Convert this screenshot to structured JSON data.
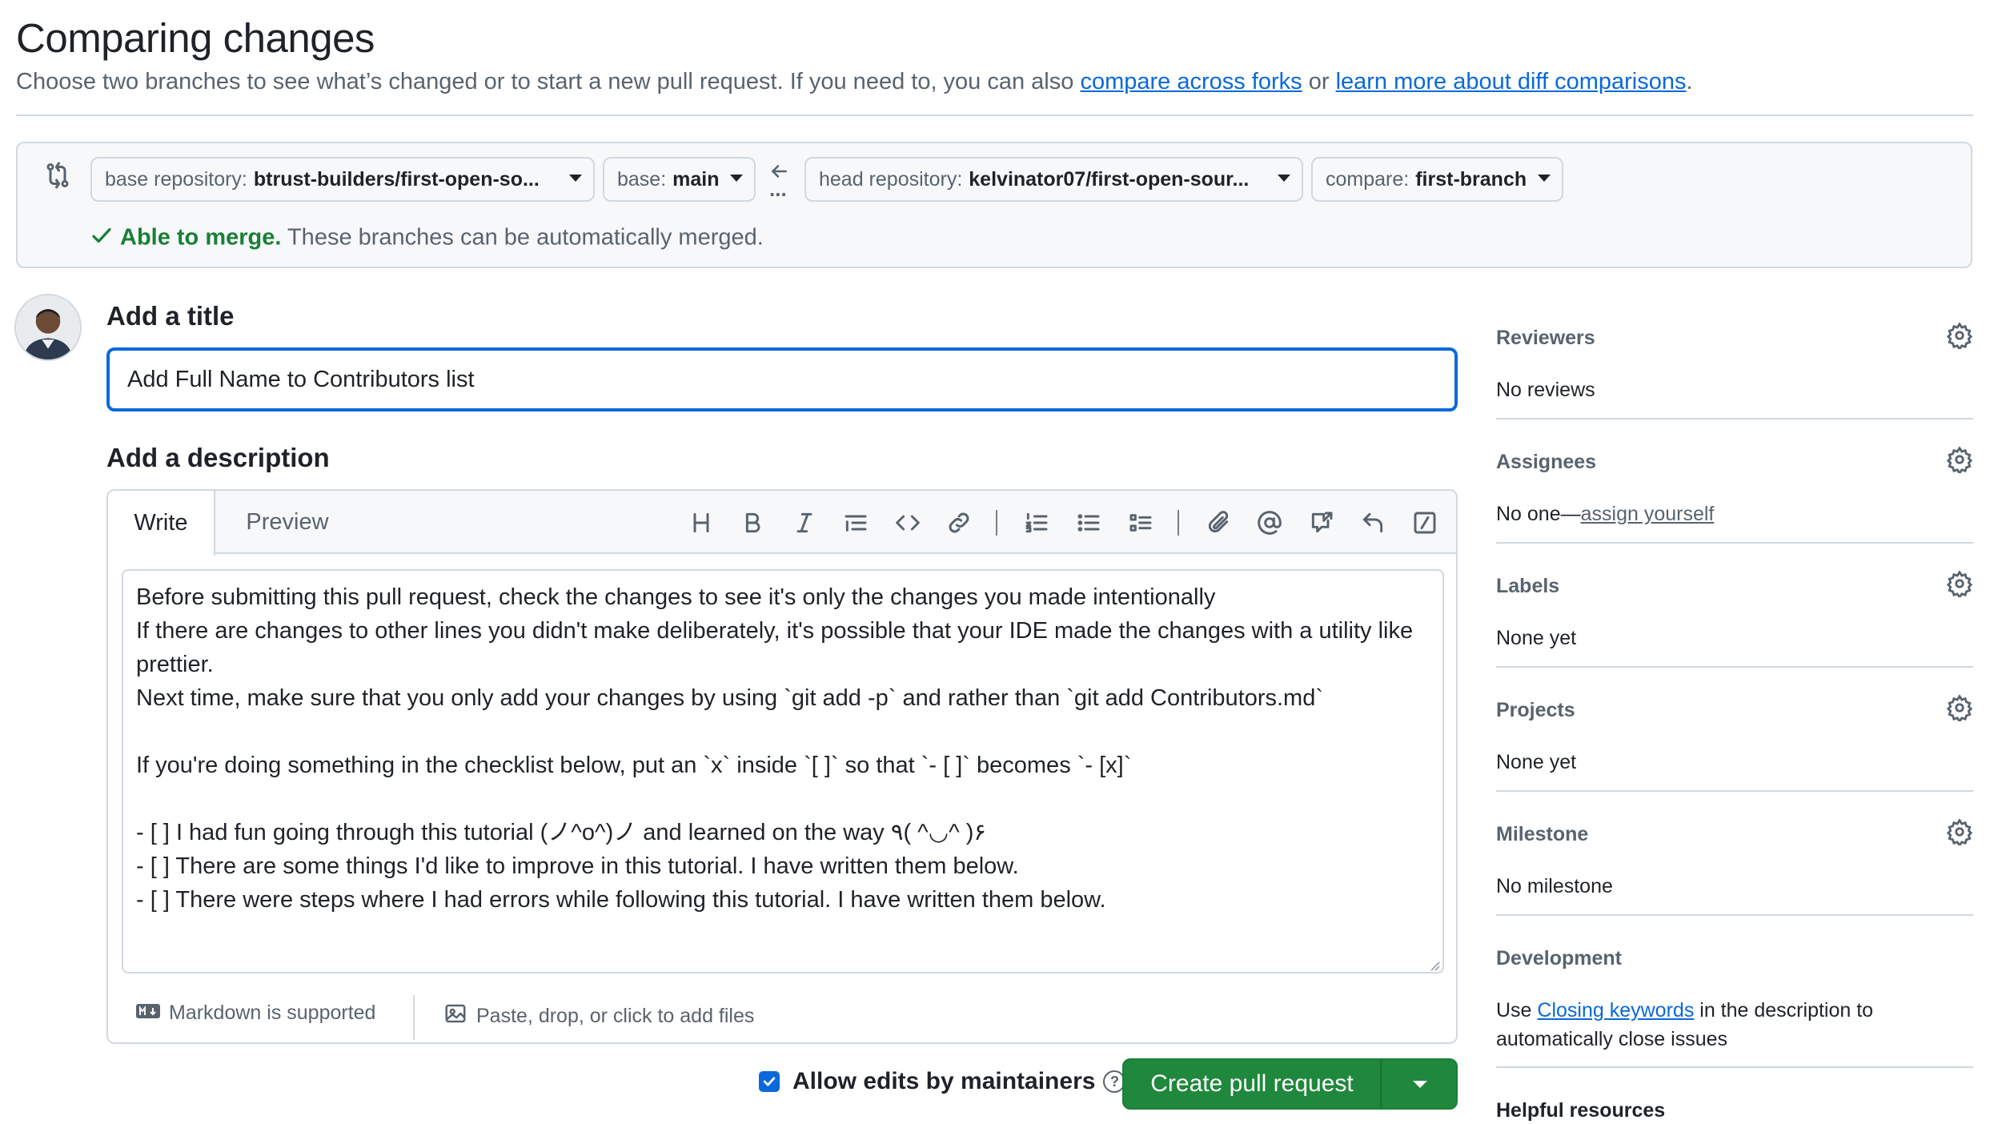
{
  "page": {
    "title": "Comparing changes",
    "subtitle_pre": "Choose two branches to see what’s changed or to start a new pull request. If you need to, you can also ",
    "link_forks": "compare across forks",
    "subtitle_mid": " or ",
    "link_learn": "learn more about diff comparisons",
    "subtitle_end": "."
  },
  "compare": {
    "base_repo_label": "base repository:",
    "base_repo_value": "btrust-builders/first-open-so...",
    "base_label": "base:",
    "base_value": "main",
    "dots": "...",
    "head_repo_label": "head repository:",
    "head_repo_value": "kelvinator07/first-open-sour...",
    "compare_label": "compare:",
    "compare_value": "first-branch",
    "merge_status_bold": "Able to merge.",
    "merge_status_text": " These branches can be automatically merged.",
    "status_color": "#1a7f37"
  },
  "form": {
    "title_label": "Add a title",
    "title_value": "Add Full Name to Contributors list",
    "desc_label": "Add a description",
    "tab_write": "Write",
    "tab_preview": "Preview",
    "body": "Before submitting this pull request, check the changes to see it's only the changes you made intentionally\nIf there are changes to other lines you didn't make deliberately, it's possible that your IDE made the changes with a utility like prettier.\nNext time, make sure that you only add your changes by using `git add -p` and rather than `git add Contributors.md`\n\nIf you're doing something in the checklist below, put an `x` inside `[ ]` so that `- [ ]` becomes `- [x]`\n\n- [ ] I had fun going through this tutorial (ノ^o^)ノ and learned on the way ٩( ^◡^ )۶\n- [ ] There are some things I'd like to improve in this tutorial. I have written them below.\n- [ ] There were steps where I had errors while following this tutorial. I have written them below.",
    "markdown_note": "Markdown is supported",
    "attach_note": "Paste, drop, or click to add files",
    "allow_edits_label": "Allow edits by maintainers",
    "allow_edits_checked": true,
    "help_glyph": "?",
    "create_button": "Create pull request",
    "accent_color": "#0969da",
    "button_color": "#1f883d"
  },
  "toolbar_icons": [
    "heading-icon",
    "bold-icon",
    "italic-icon",
    "quote-icon",
    "code-icon",
    "link-icon",
    "ordered-list-icon",
    "unordered-list-icon",
    "task-list-icon",
    "attach-icon",
    "mention-icon",
    "cross-reference-icon",
    "saved-reply-icon",
    "slash-commands-icon"
  ],
  "sidebar": {
    "reviewers_title": "Reviewers",
    "reviewers_value": "No reviews",
    "assignees_title": "Assignees",
    "assignees_pre": "No one—",
    "assignees_link": "assign yourself",
    "labels_title": "Labels",
    "labels_value": "None yet",
    "projects_title": "Projects",
    "projects_value": "None yet",
    "milestone_title": "Milestone",
    "milestone_value": "No milestone",
    "development_title": "Development",
    "development_pre": "Use ",
    "development_link": "Closing keywords",
    "development_post": " in the description to automatically close issues",
    "helpful_title": "Helpful resources"
  }
}
